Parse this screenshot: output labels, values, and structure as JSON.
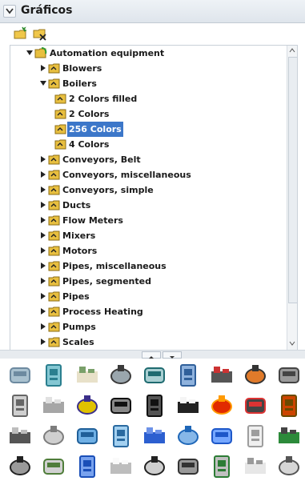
{
  "panel": {
    "title": "Gráficos",
    "collapse_icon": "chevron-down-icon"
  },
  "toolbar": {
    "buttons": [
      {
        "name": "new-folder-button",
        "icon": "new-folder-icon"
      },
      {
        "name": "delete-folder-button",
        "icon": "delete-folder-icon"
      }
    ]
  },
  "tree": {
    "root": {
      "label": "Automation equipment",
      "expanded": true
    },
    "items": [
      {
        "label": "Blowers",
        "level": 1,
        "expanded": false,
        "has_children": true
      },
      {
        "label": "Boilers",
        "level": 1,
        "expanded": true,
        "has_children": true
      },
      {
        "label": "2 Colors filled",
        "level": 2,
        "has_children": false
      },
      {
        "label": "2 Colors",
        "level": 2,
        "has_children": false
      },
      {
        "label": "256 Colors",
        "level": 2,
        "has_children": false,
        "selected": true
      },
      {
        "label": "4 Colors",
        "level": 2,
        "has_children": false
      },
      {
        "label": "Conveyors, Belt",
        "level": 1,
        "expanded": false,
        "has_children": true
      },
      {
        "label": "Conveyors, miscellaneous",
        "level": 1,
        "expanded": false,
        "has_children": true
      },
      {
        "label": "Conveyors, simple",
        "level": 1,
        "expanded": false,
        "has_children": true
      },
      {
        "label": "Ducts",
        "level": 1,
        "expanded": false,
        "has_children": true
      },
      {
        "label": "Flow Meters",
        "level": 1,
        "expanded": false,
        "has_children": true
      },
      {
        "label": "Mixers",
        "level": 1,
        "expanded": false,
        "has_children": true
      },
      {
        "label": "Motors",
        "level": 1,
        "expanded": false,
        "has_children": true
      },
      {
        "label": "Pipes, miscellaneous",
        "level": 1,
        "expanded": false,
        "has_children": true
      },
      {
        "label": "Pipes, segmented",
        "level": 1,
        "expanded": false,
        "has_children": true
      },
      {
        "label": "Pipes",
        "level": 1,
        "expanded": false,
        "has_children": true
      },
      {
        "label": "Process Heating",
        "level": 1,
        "expanded": false,
        "has_children": true
      },
      {
        "label": "Pumps",
        "level": 1,
        "expanded": false,
        "has_children": true
      },
      {
        "label": "Scales",
        "level": 1,
        "expanded": false,
        "has_children": true
      }
    ]
  },
  "gallery": {
    "icons": [
      "boiler-gray-icon",
      "tank-teal-icon",
      "cabinet-beige-icon",
      "boiler-horizontal-icon",
      "manifold-boiler-icon",
      "tank-blue-icon",
      "valve-stack-icon",
      "burner-icon",
      "flue-icon",
      "control-panel-icon",
      "hopper-gray-icon",
      "boiler-blue-purple-icon",
      "pipe-black-icon",
      "heater-black-icon",
      "furnace-window-icon",
      "fire-box-orange-icon",
      "burner-red-icon",
      "grill-icon",
      "pump-unit-icon",
      "column-boiler-icon",
      "tank-blue-2-icon",
      "boiler-blue-icon",
      "boiler-blue-square-icon",
      "boiler-low-blue-icon",
      "panel-blue-icon",
      "box-gray-icon",
      "board-green-icon",
      "cabinet-dark-icon",
      "boiler-green-icon",
      "cylinder-blue-icon",
      "cabinet-white-icon",
      "boiler-bank-icon",
      "boiler-arm-icon",
      "valve-green-icon",
      "box-white-icon",
      "box-shadow-icon"
    ]
  }
}
